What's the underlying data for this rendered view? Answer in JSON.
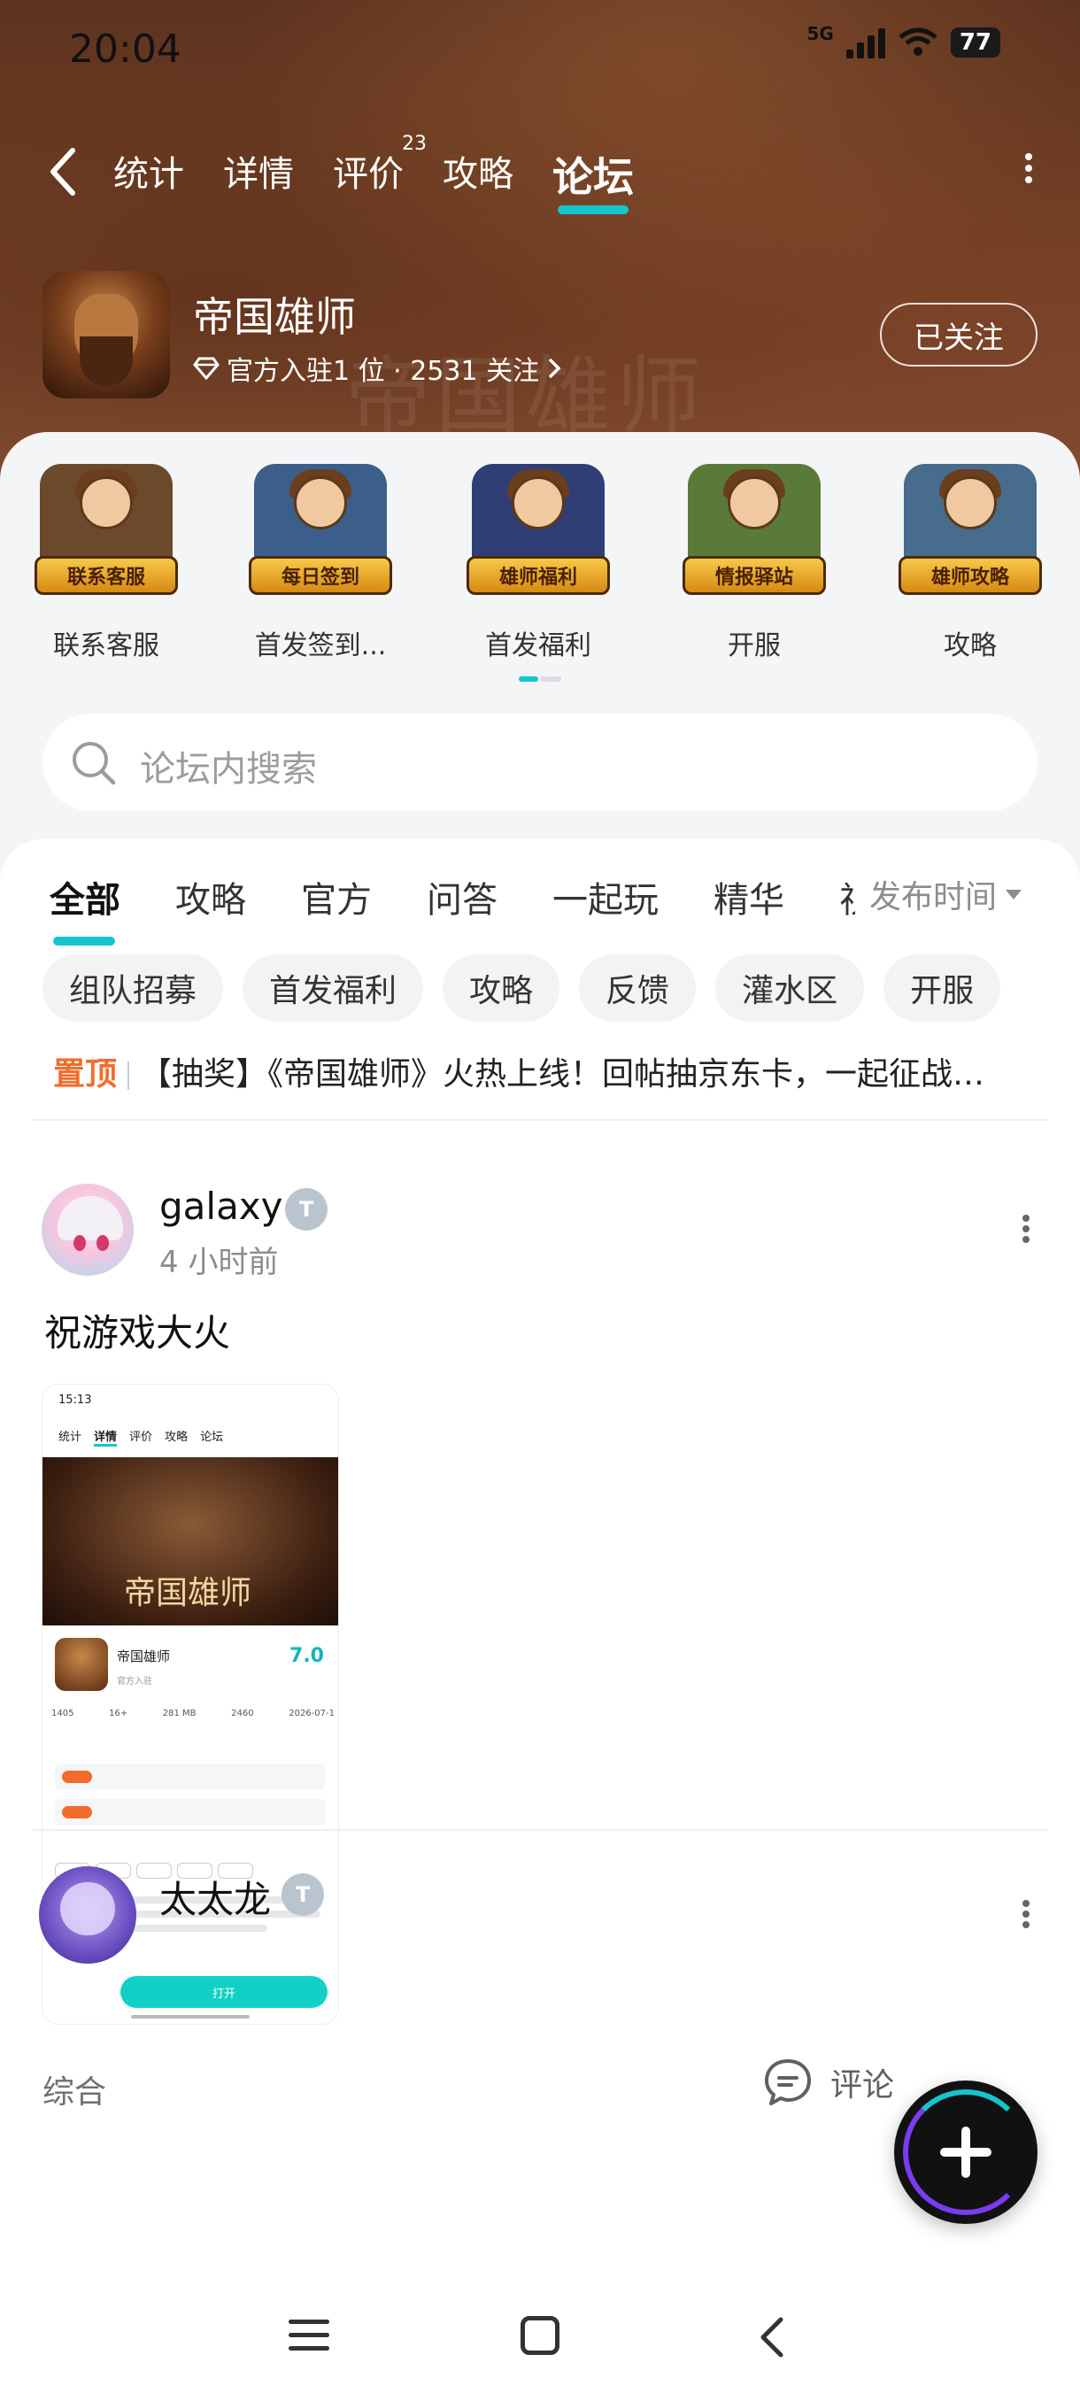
{
  "status_bar": {
    "time": "20:04",
    "network": "5G",
    "battery": "77"
  },
  "top_nav": {
    "tabs": [
      {
        "label": "统计"
      },
      {
        "label": "详情"
      },
      {
        "label": "评价",
        "sup": "23"
      },
      {
        "label": "攻略"
      },
      {
        "label": "论坛",
        "active": true
      }
    ]
  },
  "app": {
    "name": "帝国雄师",
    "meta": "官方入驻1 位 · 2531 关注",
    "follow_label": "已关注",
    "watermark": "帝国雄师"
  },
  "features": [
    {
      "label": "联系客服",
      "banner": "联系客服",
      "color": "#6b4a2b"
    },
    {
      "label": "首发签到...",
      "banner": "每日签到",
      "color": "#3b5f8a"
    },
    {
      "label": "首发福利",
      "banner": "雄师福利",
      "color": "#2f3f75"
    },
    {
      "label": "开服",
      "banner": "情报驿站",
      "color": "#5a7a3a"
    },
    {
      "label": "攻略",
      "banner": "雄师攻略",
      "color": "#476c8c"
    }
  ],
  "search": {
    "placeholder": "论坛内搜索"
  },
  "filter_tabs": [
    {
      "label": "全部",
      "active": true
    },
    {
      "label": "攻略"
    },
    {
      "label": "官方"
    },
    {
      "label": "问答"
    },
    {
      "label": "一起玩"
    },
    {
      "label": "精华"
    },
    {
      "label": "视"
    }
  ],
  "sort_label": "发布时间",
  "chips": [
    "组队招募",
    "首发福利",
    "攻略",
    "反馈",
    "灌水区",
    "开服"
  ],
  "pinned": {
    "tag": "置顶",
    "text": "【抽奖】《帝国雄师》火热上线！回帖抽京东卡，一起征战…"
  },
  "post1": {
    "user": "galaxy",
    "time": "4 小时前",
    "title": "祝游戏大火",
    "category": "综合",
    "comment_label": "评论",
    "screenshot": {
      "time": "15:13",
      "nav": [
        "统计",
        "详情",
        "评价",
        "攻略",
        "论坛"
      ],
      "hero_title": "帝国雄师",
      "app_name": "帝国雄师",
      "official": "官方入驻",
      "score": "7.0",
      "stats": [
        "1405",
        "16+",
        "281 MB",
        "2460",
        "2026-07-1"
      ],
      "open_label": "打开"
    }
  },
  "post2": {
    "user": "太太龙"
  },
  "colors": {
    "accent": "#15c5ce",
    "pinned": "#f36b2a"
  }
}
